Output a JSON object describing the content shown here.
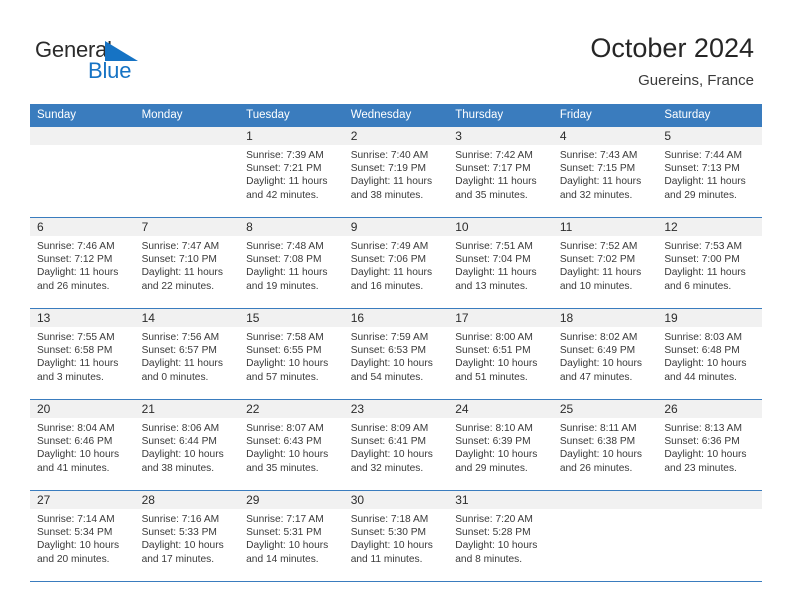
{
  "brand": {
    "name_top": "General",
    "name_bottom": "Blue",
    "color_primary": "#1673c4",
    "color_text": "#2b2b2b"
  },
  "header": {
    "title": "October 2024",
    "subtitle": "Guereins, France"
  },
  "theme": {
    "header_bg": "#3a7cbe",
    "header_text": "#ffffff",
    "daynum_bg": "#f1f1f1",
    "rule_color": "#3a7cbe",
    "body_text": "#3a3a3a"
  },
  "weekday_headers": [
    "Sunday",
    "Monday",
    "Tuesday",
    "Wednesday",
    "Thursday",
    "Friday",
    "Saturday"
  ],
  "weeks": [
    [
      {
        "day": "",
        "blank": true,
        "sunrise": "",
        "sunset": "",
        "daylight_line1": "",
        "daylight_line2": ""
      },
      {
        "day": "",
        "blank": true,
        "sunrise": "",
        "sunset": "",
        "daylight_line1": "",
        "daylight_line2": ""
      },
      {
        "day": "1",
        "sunrise": "Sunrise: 7:39 AM",
        "sunset": "Sunset: 7:21 PM",
        "daylight_line1": "Daylight: 11 hours",
        "daylight_line2": "and 42 minutes."
      },
      {
        "day": "2",
        "sunrise": "Sunrise: 7:40 AM",
        "sunset": "Sunset: 7:19 PM",
        "daylight_line1": "Daylight: 11 hours",
        "daylight_line2": "and 38 minutes."
      },
      {
        "day": "3",
        "sunrise": "Sunrise: 7:42 AM",
        "sunset": "Sunset: 7:17 PM",
        "daylight_line1": "Daylight: 11 hours",
        "daylight_line2": "and 35 minutes."
      },
      {
        "day": "4",
        "sunrise": "Sunrise: 7:43 AM",
        "sunset": "Sunset: 7:15 PM",
        "daylight_line1": "Daylight: 11 hours",
        "daylight_line2": "and 32 minutes."
      },
      {
        "day": "5",
        "sunrise": "Sunrise: 7:44 AM",
        "sunset": "Sunset: 7:13 PM",
        "daylight_line1": "Daylight: 11 hours",
        "daylight_line2": "and 29 minutes."
      }
    ],
    [
      {
        "day": "6",
        "sunrise": "Sunrise: 7:46 AM",
        "sunset": "Sunset: 7:12 PM",
        "daylight_line1": "Daylight: 11 hours",
        "daylight_line2": "and 26 minutes."
      },
      {
        "day": "7",
        "sunrise": "Sunrise: 7:47 AM",
        "sunset": "Sunset: 7:10 PM",
        "daylight_line1": "Daylight: 11 hours",
        "daylight_line2": "and 22 minutes."
      },
      {
        "day": "8",
        "sunrise": "Sunrise: 7:48 AM",
        "sunset": "Sunset: 7:08 PM",
        "daylight_line1": "Daylight: 11 hours",
        "daylight_line2": "and 19 minutes."
      },
      {
        "day": "9",
        "sunrise": "Sunrise: 7:49 AM",
        "sunset": "Sunset: 7:06 PM",
        "daylight_line1": "Daylight: 11 hours",
        "daylight_line2": "and 16 minutes."
      },
      {
        "day": "10",
        "sunrise": "Sunrise: 7:51 AM",
        "sunset": "Sunset: 7:04 PM",
        "daylight_line1": "Daylight: 11 hours",
        "daylight_line2": "and 13 minutes."
      },
      {
        "day": "11",
        "sunrise": "Sunrise: 7:52 AM",
        "sunset": "Sunset: 7:02 PM",
        "daylight_line1": "Daylight: 11 hours",
        "daylight_line2": "and 10 minutes."
      },
      {
        "day": "12",
        "sunrise": "Sunrise: 7:53 AM",
        "sunset": "Sunset: 7:00 PM",
        "daylight_line1": "Daylight: 11 hours",
        "daylight_line2": "and 6 minutes."
      }
    ],
    [
      {
        "day": "13",
        "sunrise": "Sunrise: 7:55 AM",
        "sunset": "Sunset: 6:58 PM",
        "daylight_line1": "Daylight: 11 hours",
        "daylight_line2": "and 3 minutes."
      },
      {
        "day": "14",
        "sunrise": "Sunrise: 7:56 AM",
        "sunset": "Sunset: 6:57 PM",
        "daylight_line1": "Daylight: 11 hours",
        "daylight_line2": "and 0 minutes."
      },
      {
        "day": "15",
        "sunrise": "Sunrise: 7:58 AM",
        "sunset": "Sunset: 6:55 PM",
        "daylight_line1": "Daylight: 10 hours",
        "daylight_line2": "and 57 minutes."
      },
      {
        "day": "16",
        "sunrise": "Sunrise: 7:59 AM",
        "sunset": "Sunset: 6:53 PM",
        "daylight_line1": "Daylight: 10 hours",
        "daylight_line2": "and 54 minutes."
      },
      {
        "day": "17",
        "sunrise": "Sunrise: 8:00 AM",
        "sunset": "Sunset: 6:51 PM",
        "daylight_line1": "Daylight: 10 hours",
        "daylight_line2": "and 51 minutes."
      },
      {
        "day": "18",
        "sunrise": "Sunrise: 8:02 AM",
        "sunset": "Sunset: 6:49 PM",
        "daylight_line1": "Daylight: 10 hours",
        "daylight_line2": "and 47 minutes."
      },
      {
        "day": "19",
        "sunrise": "Sunrise: 8:03 AM",
        "sunset": "Sunset: 6:48 PM",
        "daylight_line1": "Daylight: 10 hours",
        "daylight_line2": "and 44 minutes."
      }
    ],
    [
      {
        "day": "20",
        "sunrise": "Sunrise: 8:04 AM",
        "sunset": "Sunset: 6:46 PM",
        "daylight_line1": "Daylight: 10 hours",
        "daylight_line2": "and 41 minutes."
      },
      {
        "day": "21",
        "sunrise": "Sunrise: 8:06 AM",
        "sunset": "Sunset: 6:44 PM",
        "daylight_line1": "Daylight: 10 hours",
        "daylight_line2": "and 38 minutes."
      },
      {
        "day": "22",
        "sunrise": "Sunrise: 8:07 AM",
        "sunset": "Sunset: 6:43 PM",
        "daylight_line1": "Daylight: 10 hours",
        "daylight_line2": "and 35 minutes."
      },
      {
        "day": "23",
        "sunrise": "Sunrise: 8:09 AM",
        "sunset": "Sunset: 6:41 PM",
        "daylight_line1": "Daylight: 10 hours",
        "daylight_line2": "and 32 minutes."
      },
      {
        "day": "24",
        "sunrise": "Sunrise: 8:10 AM",
        "sunset": "Sunset: 6:39 PM",
        "daylight_line1": "Daylight: 10 hours",
        "daylight_line2": "and 29 minutes."
      },
      {
        "day": "25",
        "sunrise": "Sunrise: 8:11 AM",
        "sunset": "Sunset: 6:38 PM",
        "daylight_line1": "Daylight: 10 hours",
        "daylight_line2": "and 26 minutes."
      },
      {
        "day": "26",
        "sunrise": "Sunrise: 8:13 AM",
        "sunset": "Sunset: 6:36 PM",
        "daylight_line1": "Daylight: 10 hours",
        "daylight_line2": "and 23 minutes."
      }
    ],
    [
      {
        "day": "27",
        "sunrise": "Sunrise: 7:14 AM",
        "sunset": "Sunset: 5:34 PM",
        "daylight_line1": "Daylight: 10 hours",
        "daylight_line2": "and 20 minutes."
      },
      {
        "day": "28",
        "sunrise": "Sunrise: 7:16 AM",
        "sunset": "Sunset: 5:33 PM",
        "daylight_line1": "Daylight: 10 hours",
        "daylight_line2": "and 17 minutes."
      },
      {
        "day": "29",
        "sunrise": "Sunrise: 7:17 AM",
        "sunset": "Sunset: 5:31 PM",
        "daylight_line1": "Daylight: 10 hours",
        "daylight_line2": "and 14 minutes."
      },
      {
        "day": "30",
        "sunrise": "Sunrise: 7:18 AM",
        "sunset": "Sunset: 5:30 PM",
        "daylight_line1": "Daylight: 10 hours",
        "daylight_line2": "and 11 minutes."
      },
      {
        "day": "31",
        "sunrise": "Sunrise: 7:20 AM",
        "sunset": "Sunset: 5:28 PM",
        "daylight_line1": "Daylight: 10 hours",
        "daylight_line2": "and 8 minutes."
      },
      {
        "day": "",
        "blank": true,
        "sunrise": "",
        "sunset": "",
        "daylight_line1": "",
        "daylight_line2": ""
      },
      {
        "day": "",
        "blank": true,
        "sunrise": "",
        "sunset": "",
        "daylight_line1": "",
        "daylight_line2": ""
      }
    ]
  ]
}
